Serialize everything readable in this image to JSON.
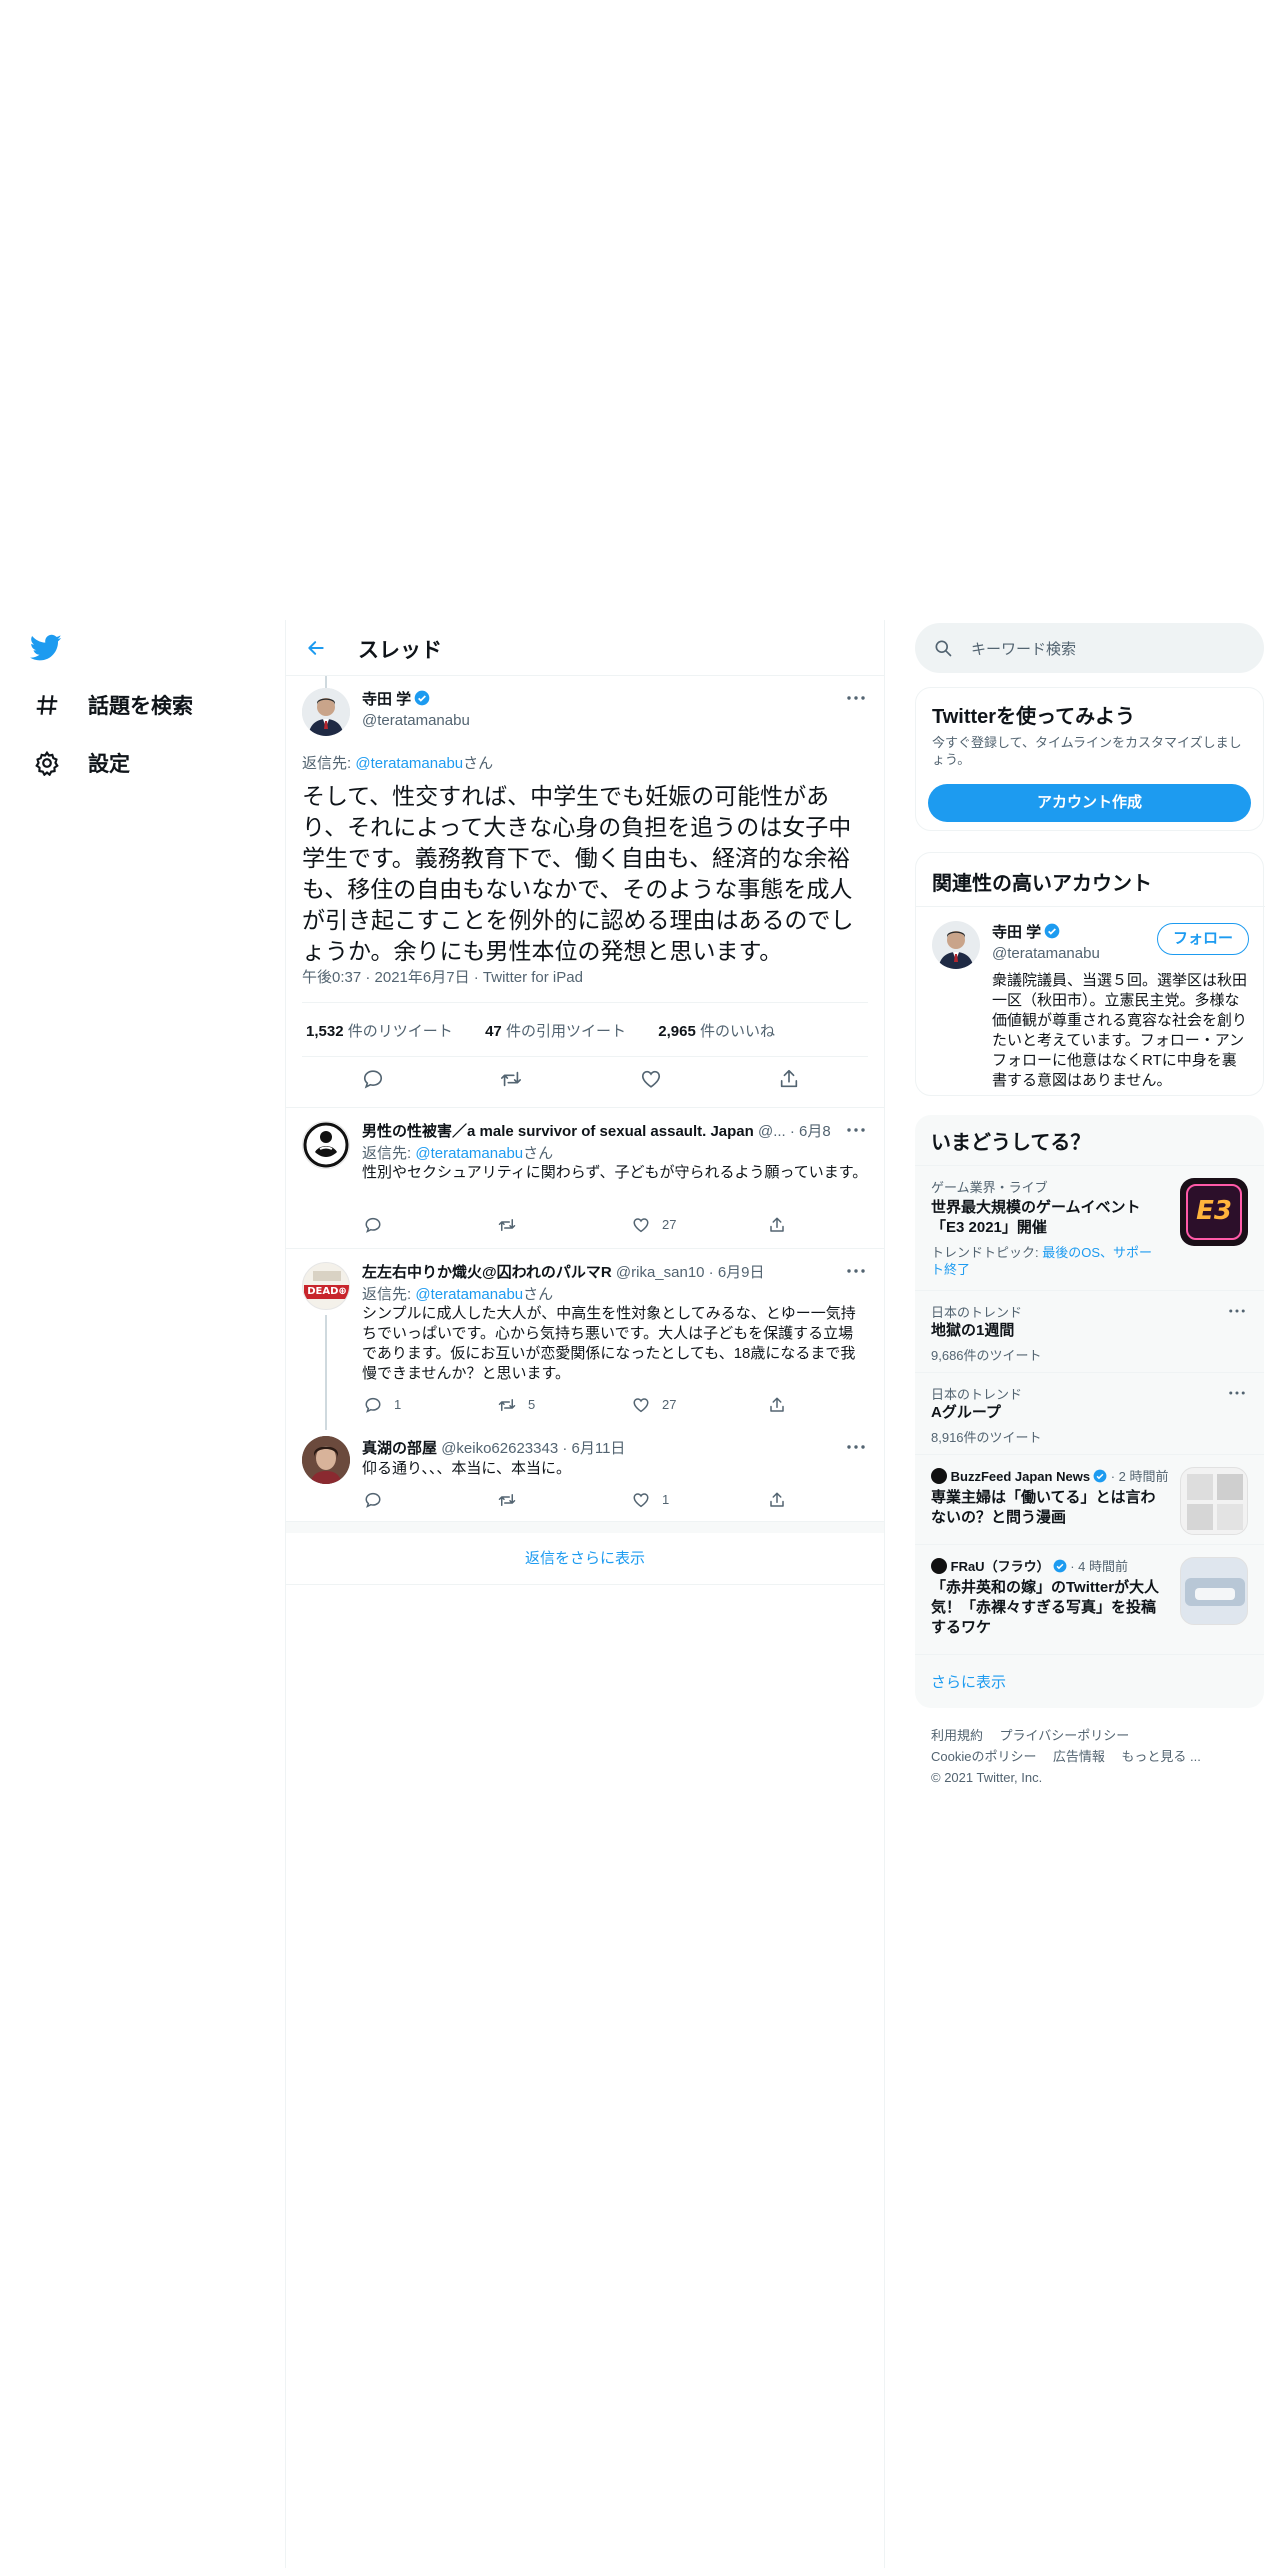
{
  "nav": {
    "explore_label": "話題を検索",
    "settings_label": "設定"
  },
  "header": {
    "title": "スレッド"
  },
  "main_tweet": {
    "name": "寺田 学",
    "handle": "@teratamanabu",
    "reply_prefix": "返信先: ",
    "reply_to": "@teratamanabu",
    "reply_suffix": "さん",
    "text": "そして、性交すれば、中学生でも妊娠の可能性があり、それによって大きな心身の負担を追うのは女子中学生です。義務教育下で、働く自由も、経済的な余裕も、移住の自由もないなかで、そのような事態を成人が引き起こすことを例外的に認める理由はあるのでしょうか。余りにも男性本位の発想と思います。",
    "meta": "午後0:37 · 2021年6月7日 · Twitter for iPad",
    "retweets": "1,532",
    "retweets_label": "件のリツイート",
    "quotes": "47",
    "quotes_label": "件の引用ツイート",
    "likes": "2,965",
    "likes_label": "件のいいね"
  },
  "replies": [
    {
      "name": "男性の性被害／a male survivor of sexual assault. Japan",
      "handle": "@...",
      "date": "· 6月8日",
      "reply_prefix": "返信先: ",
      "reply_to": "@teratamanabu",
      "reply_suffix": "さん",
      "text": "性別やセクシュアリティに関わらず、子どもが守られるよう願っています。",
      "reply_count": "",
      "retweet_count": "",
      "like_count": "27"
    },
    {
      "name": "左左右中りか熾火@囚われのパルマR",
      "handle": "@rika_san10",
      "date": "· 6月9日",
      "reply_prefix": "返信先: ",
      "reply_to": "@teratamanabu",
      "reply_suffix": "さん",
      "text": "シンプルに成人した大人が、中高生を性対象としてみるな、とゆー一気持ちでいっぱいです。心から気持ち悪いです。大人は子どもを保護する立場であります。仮にお互いが恋愛関係になったとしても、18歳になるまで我慢できませんか？と思います。",
      "avatar_text": "DEAD⊕",
      "reply_count": "1",
      "retweet_count": "5",
      "like_count": "27"
    },
    {
      "name": "真湖の部屋",
      "handle": "@keiko62623343",
      "date": "· 6月11日",
      "text": "仰る通り、、、本当に、本当に。",
      "reply_count": "",
      "retweet_count": "",
      "like_count": "1"
    }
  ],
  "show_more_replies": "返信をさらに表示",
  "search": {
    "placeholder": "キーワード検索"
  },
  "signup": {
    "title": "Twitterを使ってみよう",
    "desc": "今すぐ登録して、タイムラインをカスタマイズしましょう。",
    "button": "アカウント作成"
  },
  "related": {
    "title": "関連性の高いアカウント",
    "name": "寺田 学",
    "handle": "@teratamanabu",
    "follow": "フォロー",
    "bio": "衆議院議員、当選５回。選挙区は秋田一区（秋田市）。立憲民主党。多様な価値観が尊重される寛容な社会を創りたいと考えています。フォロー・アンフォローに他意はなくRTに中身を裏書する意図はありません。"
  },
  "trends": {
    "title": "いまどうしてる？",
    "items": [
      {
        "context": "ゲーム業界・ライブ",
        "title": "世界最大規模のゲームイベント「E3 2021」開催",
        "topic_prefix": "トレンドトピック: ",
        "topic": "最後のOS、サポート終了",
        "image_text": "E3"
      },
      {
        "context": "日本のトレンド",
        "title": "地獄の1週間",
        "count": "9,686件のツイート"
      },
      {
        "context": "日本のトレンド",
        "title": "Aグループ",
        "count": "8,916件のツイート"
      },
      {
        "source": "BuzzFeed Japan News",
        "time": "· 2 時間前",
        "title": "専業主婦は「働いてる」とは言わないの？と問う漫画"
      },
      {
        "source": "FRaU（フラウ）",
        "time": "· 4 時間前",
        "title": "「赤井英和の嫁」のTwitterが大人気！「赤裸々すぎる写真」を投稿するワケ"
      }
    ],
    "show_more": "さらに表示"
  },
  "footer": {
    "links": [
      "利用規約",
      "プライバシーポリシー",
      "Cookieのポリシー",
      "広告情報",
      "もっと見る ..."
    ],
    "copyright": "© 2021 Twitter, Inc."
  },
  "colors": {
    "accent": "#1d9bf0",
    "text": "#0f1419",
    "muted": "#536471",
    "border": "#eff3f4",
    "panel": "#f7f9f9"
  }
}
